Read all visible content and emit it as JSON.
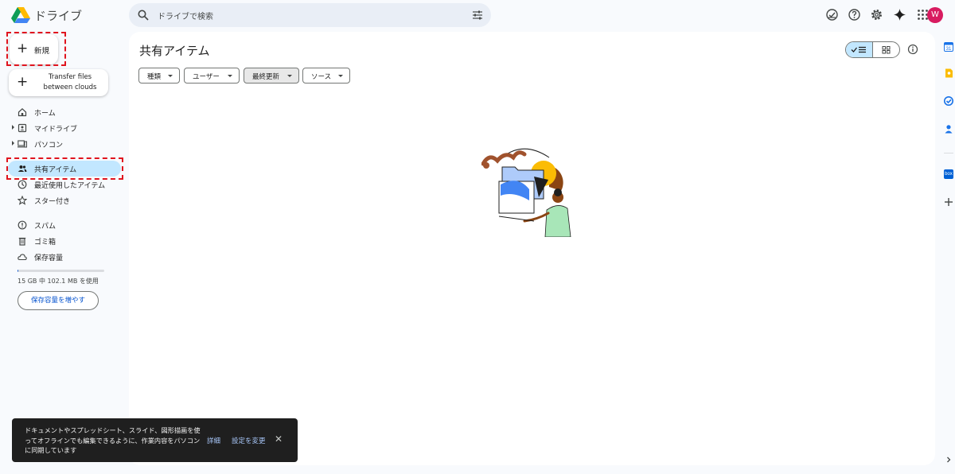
{
  "app": {
    "title": "ドライブ",
    "logo_icon": "google-drive-logo"
  },
  "search": {
    "placeholder": "ドライブで検索",
    "icon": "search-icon",
    "filter_icon": "tune-icon"
  },
  "header_actions": {
    "icons": [
      "offline-status-icon",
      "help-icon",
      "settings-icon",
      "gemini-icon",
      "apps-grid-icon"
    ],
    "avatar_initial": "W",
    "avatar_color": "#d81b60"
  },
  "sidebar": {
    "new_button": "新規",
    "transfer_button": "Transfer files between clouds",
    "items": [
      {
        "label": "ホーム",
        "icon": "home-icon",
        "expandable": false,
        "active": false
      },
      {
        "label": "マイドライブ",
        "icon": "my-drive-icon",
        "expandable": true,
        "active": false
      },
      {
        "label": "パソコン",
        "icon": "computer-icon",
        "expandable": true,
        "active": false
      },
      {
        "label": "共有アイテム",
        "icon": "shared-icon",
        "expandable": false,
        "active": true
      },
      {
        "label": "最近使用したアイテム",
        "icon": "recent-icon",
        "expandable": false,
        "active": false
      },
      {
        "label": "スター付き",
        "icon": "star-icon",
        "expandable": false,
        "active": false
      },
      {
        "label": "スパム",
        "icon": "spam-icon",
        "expandable": false,
        "active": false
      },
      {
        "label": "ゴミ箱",
        "icon": "trash-icon",
        "expandable": false,
        "active": false
      },
      {
        "label": "保存容量",
        "icon": "cloud-icon",
        "expandable": false,
        "active": false
      }
    ],
    "storage": {
      "used_text": "15 GB 中 102.1 MB を使用",
      "used_fraction": 0.0068,
      "upgrade_button": "保存容量を増やす"
    }
  },
  "main": {
    "page_title": "共有アイテム",
    "filters": [
      {
        "label": "種類",
        "selected": false
      },
      {
        "label": "ユーザー",
        "selected": false
      },
      {
        "label": "最終更新",
        "selected": true
      },
      {
        "label": "ソース",
        "selected": false
      }
    ],
    "view_toggle": {
      "active": "list"
    },
    "info_icon": "info-icon"
  },
  "toast": {
    "message": "ドキュメントやスプレッドシート、スライド、図形描画を使ってオフラインでも編集できるように、作業内容をパソコンに同期しています",
    "action_details": "詳細",
    "action_settings": "設定を変更"
  },
  "right_rail": {
    "icons": [
      "calendar-icon",
      "keep-icon",
      "tasks-icon",
      "contacts-icon",
      "box-icon",
      "add-icon",
      "expand-icon"
    ],
    "box_label": "box"
  },
  "colors": {
    "accent": "#0b57d0",
    "active_nav": "#c2e7ff",
    "annotation_red": "#e0141e"
  }
}
